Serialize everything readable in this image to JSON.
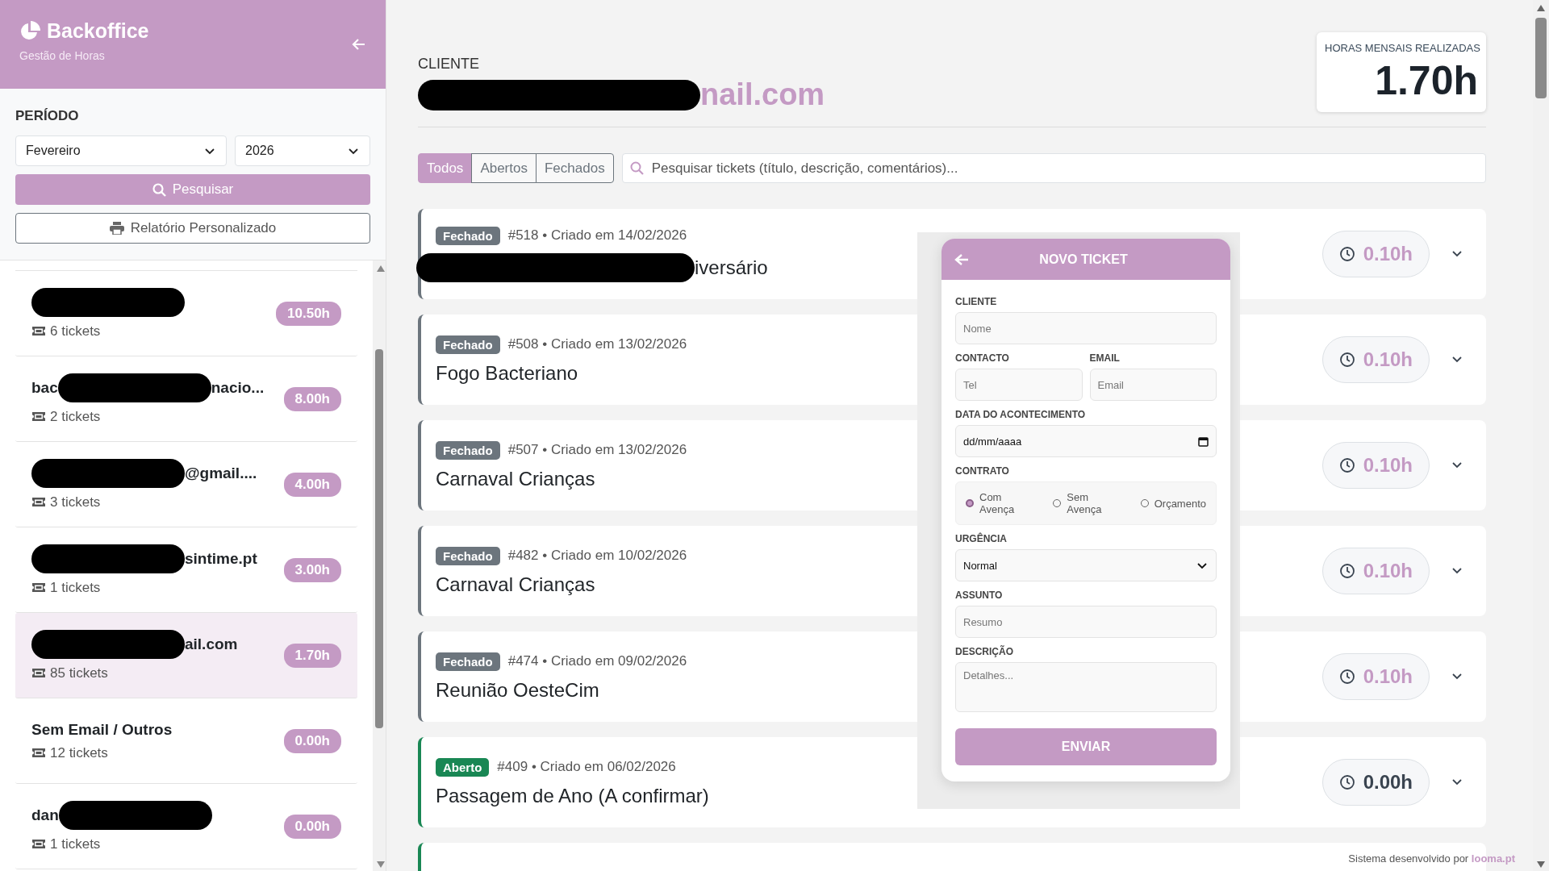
{
  "sidebar": {
    "brand": "Backoffice",
    "subtitle": "Gestão de Horas",
    "period_label": "PERÍODO",
    "month": "Fevereiro",
    "year": "2026",
    "search_button": "Pesquisar",
    "report_button": "Relatório Personalizado",
    "clients": [
      {
        "name": [
          {
            "kind": "redacted"
          }
        ],
        "tickets": "6 tickets",
        "hours": "10.50h",
        "selected": false
      },
      {
        "name": [
          {
            "kind": "text",
            "text": "bac"
          },
          {
            "kind": "redacted"
          },
          {
            "kind": "text",
            "text": "nacio..."
          }
        ],
        "tickets": "2 tickets",
        "hours": "8.00h",
        "selected": false
      },
      {
        "name": [
          {
            "kind": "redacted"
          },
          {
            "kind": "text",
            "text": "@gmail...."
          }
        ],
        "tickets": "3 tickets",
        "hours": "4.00h",
        "selected": false
      },
      {
        "name": [
          {
            "kind": "redacted"
          },
          {
            "kind": "text",
            "text": "sintime.pt"
          }
        ],
        "tickets": "1 tickets",
        "hours": "3.00h",
        "selected": false
      },
      {
        "name": [
          {
            "kind": "redacted"
          },
          {
            "kind": "text",
            "text": "ail.com"
          }
        ],
        "tickets": "85 tickets",
        "hours": "1.70h",
        "selected": true
      },
      {
        "name": [
          {
            "kind": "text",
            "text": "Sem Email / Outros"
          }
        ],
        "tickets": "12 tickets",
        "hours": "0.00h",
        "selected": false
      },
      {
        "name": [
          {
            "kind": "text",
            "text": "dan"
          },
          {
            "kind": "redacted"
          }
        ],
        "tickets": "1 tickets",
        "hours": "0.00h",
        "selected": false
      }
    ]
  },
  "main": {
    "client_label": "CLIENTE",
    "client_name": [
      {
        "kind": "redacted"
      },
      {
        "kind": "text",
        "text": "nail.com"
      }
    ],
    "hours_card": {
      "label": "HORAS MENSAIS REALIZADAS",
      "value": "1.70h"
    },
    "filters": [
      {
        "label": "Todos",
        "selected": true
      },
      {
        "label": "Abertos",
        "selected": false
      },
      {
        "label": "Fechados",
        "selected": false
      }
    ],
    "search": {
      "placeholder": "Pesquisar tickets (título, descrição, comentários)..."
    },
    "tickets": [
      {
        "kind": "closed",
        "badge": "Fechado",
        "meta": "#518 • Criado em 14/02/2026",
        "title": [
          {
            "kind": "redacted"
          },
          {
            "kind": "text",
            "text": "iversário"
          }
        ],
        "hours": "0.10h",
        "highlighted": true
      },
      {
        "kind": "closed",
        "badge": "Fechado",
        "meta": "#508 • Criado em 13/02/2026",
        "title": [
          {
            "kind": "text",
            "text": "Fogo Bacteriano"
          }
        ],
        "hours": "0.10h",
        "highlighted": true
      },
      {
        "kind": "closed",
        "badge": "Fechado",
        "meta": "#507 • Criado em 13/02/2026",
        "title": [
          {
            "kind": "text",
            "text": "Carnaval Crianças"
          }
        ],
        "hours": "0.10h",
        "highlighted": true
      },
      {
        "kind": "closed",
        "badge": "Fechado",
        "meta": "#482 • Criado em 10/02/2026",
        "title": [
          {
            "kind": "text",
            "text": "Carnaval Crianças"
          }
        ],
        "hours": "0.10h",
        "highlighted": true
      },
      {
        "kind": "closed",
        "badge": "Fechado",
        "meta": "#474 • Criado em 09/02/2026",
        "title": [
          {
            "kind": "text",
            "text": "Reunião OesteCim"
          }
        ],
        "hours": "0.10h",
        "highlighted": true
      },
      {
        "kind": "open",
        "badge": "Aberto",
        "meta": "#409 • Criado em 06/02/2026",
        "title": [
          {
            "kind": "text",
            "text": "Passagem de Ano (A confirmar)"
          }
        ],
        "hours": "0.00h",
        "highlighted": false
      }
    ]
  },
  "modal": {
    "title": "NOVO TICKET",
    "client_label": "CLIENTE",
    "client_placeholder": "Nome",
    "contact_label": "CONTACTO",
    "contact_placeholder": "Tel",
    "email_label": "EMAIL",
    "email_placeholder": "Email",
    "date_label": "DATA DO ACONTECIMENTO",
    "date_value": "dd/mm/aaaa",
    "contract_label": "CONTRATO",
    "contract_options": [
      {
        "label": "Com Avença",
        "selected": true
      },
      {
        "label": "Sem Avença",
        "selected": false
      },
      {
        "label": "Orçamento",
        "selected": false
      }
    ],
    "urgency_label": "URGÊNCIA",
    "urgency_value": "Normal",
    "subject_label": "ASSUNTO",
    "subject_placeholder": "Resumo",
    "description_label": "DESCRIÇÃO",
    "description_placeholder": "Detalhes...",
    "submit": "ENVIAR"
  },
  "footer": {
    "text": "Sistema desenvolvido por",
    "link": "looma.pt"
  }
}
